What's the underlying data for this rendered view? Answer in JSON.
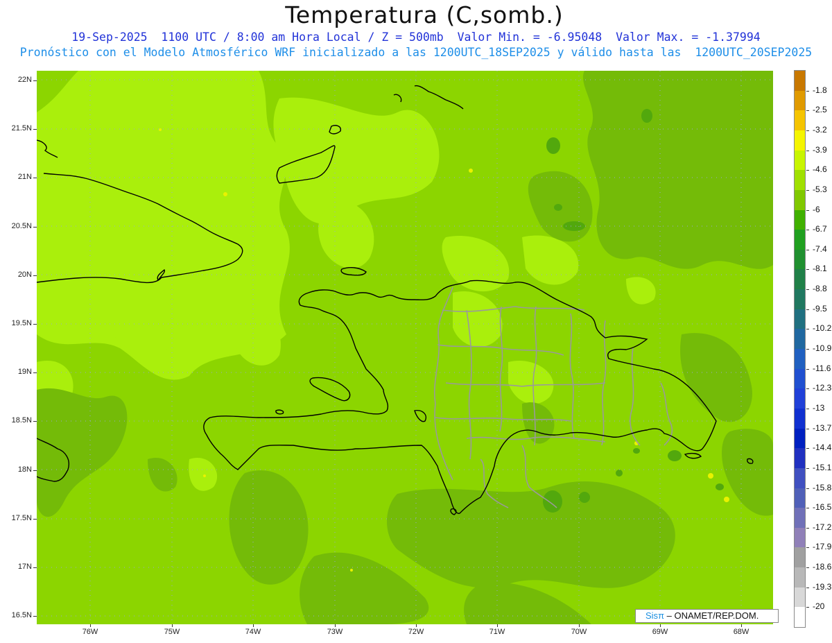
{
  "header": {
    "title": "Temperatura (C,somb.)",
    "line1": "19-Sep-2025  1100 UTC / 8:00 am Hora Local / Z = 500mb  Valor Min. = -6.95048  Valor Max. = -1.37994",
    "line2": "Pronóstico con el Modelo Atmosférico WRF inicializado a las 1200UTC_18SEP2025 y válido hasta las  1200UTC_20SEP2025"
  },
  "axes": {
    "lat_labels": [
      "22N",
      "21.5N",
      "21N",
      "20.5N",
      "20N",
      "19.5N",
      "19N",
      "18.5N",
      "18N",
      "17.5N",
      "17N",
      "16.5N"
    ],
    "lon_labels": [
      "76W",
      "75W",
      "74W",
      "73W",
      "72W",
      "71W",
      "70W",
      "69W",
      "68W"
    ]
  },
  "credit": {
    "brand": "SisPI",
    "brand_pi": "π",
    "text": " – ONAMET/REP.DOM."
  },
  "colorbar": {
    "labels": [
      "-1.8",
      "-2.5",
      "-3.2",
      "-3.9",
      "-4.6",
      "-5.3",
      "-6",
      "-6.7",
      "-7.4",
      "-8.1",
      "-8.8",
      "-9.5",
      "-10.2",
      "-10.9",
      "-11.6",
      "-12.3",
      "-13",
      "-13.7",
      "-14.4",
      "-15.1",
      "-15.8",
      "-16.5",
      "-17.2",
      "-17.9",
      "-18.6",
      "-19.3",
      "-20"
    ],
    "colors": [
      "#c87800",
      "#e09a00",
      "#f5c400",
      "#f5f500",
      "#c8f500",
      "#a0e000",
      "#80c800",
      "#40b000",
      "#20a020",
      "#209030",
      "#208048",
      "#207860",
      "#207080",
      "#2068a0",
      "#2060c0",
      "#2050d0",
      "#2040d8",
      "#1030d0",
      "#0020c0",
      "#2030c0",
      "#4050c0",
      "#5060b8",
      "#7070b8",
      "#9080b8",
      "#a0a0a0",
      "#b8b8b8",
      "#d8d8d8",
      "#ffffff"
    ]
  },
  "map_colors": {
    "base": "#8cd500",
    "light": "#aaef0c",
    "dark": "#74bb08",
    "darker": "#52a80d",
    "yellow": "#e9f200",
    "land_outline": "#000000",
    "province_lines": "#9a9a9a"
  }
}
